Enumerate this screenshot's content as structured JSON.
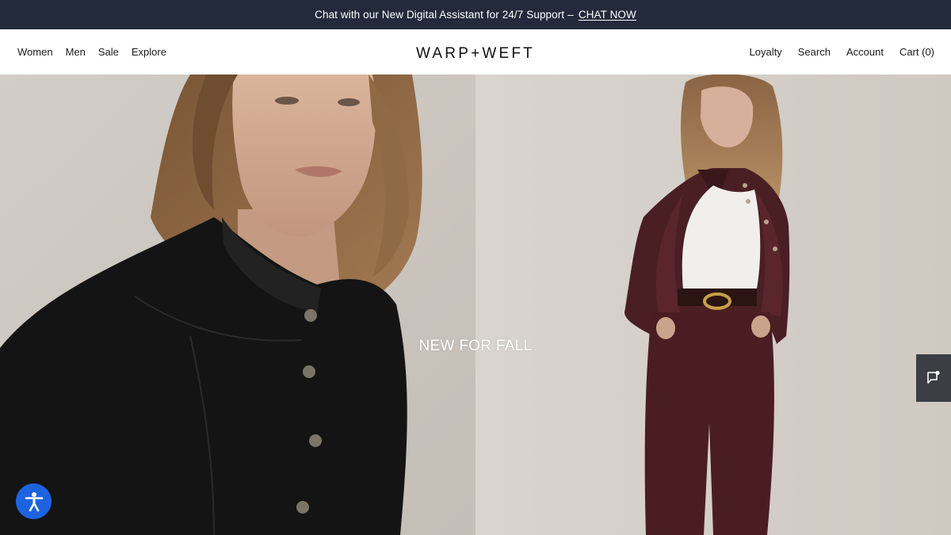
{
  "announcement": {
    "text": "Chat with our New Digital Assistant for 24/7 Support",
    "separator": "–",
    "cta": "CHAT NOW"
  },
  "nav": {
    "left": [
      "Women",
      "Men",
      "Sale",
      "Explore"
    ],
    "right": [
      "Loyalty",
      "Search",
      "Account",
      "Cart (0)"
    ]
  },
  "brand": {
    "logo": "WARP+WEFT"
  },
  "hero": {
    "title": "NEW FOR FALL"
  },
  "widgets": {
    "chat_icon": "chat-bubble-icon",
    "accessibility_icon": "accessibility-person-icon"
  },
  "colors": {
    "announcement_bg": "#232a3b",
    "widget_bg": "#3b3e43",
    "accessibility_bg": "#1d63e0"
  }
}
